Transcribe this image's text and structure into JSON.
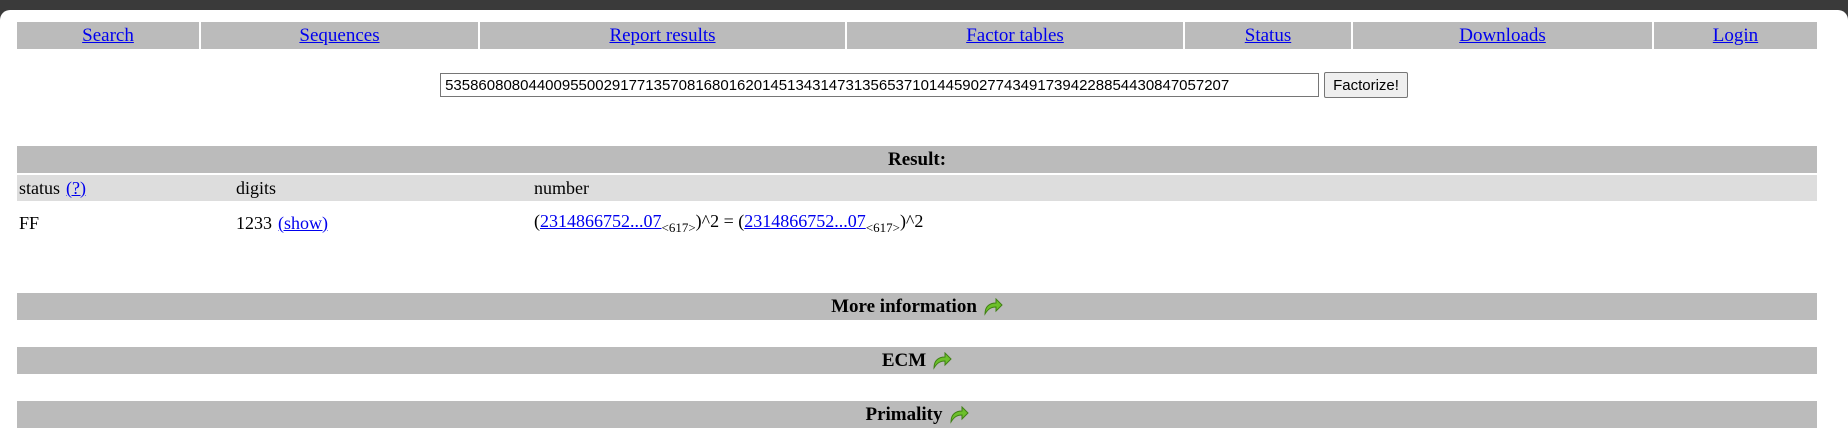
{
  "nav": [
    {
      "label": "Search",
      "name": "nav-search"
    },
    {
      "label": "Sequences",
      "name": "nav-sequences"
    },
    {
      "label": "Report results",
      "name": "nav-report-results"
    },
    {
      "label": "Factor tables",
      "name": "nav-factor-tables"
    },
    {
      "label": "Status",
      "name": "nav-status"
    },
    {
      "label": "Downloads",
      "name": "nav-downloads"
    },
    {
      "label": "Login",
      "name": "nav-login"
    }
  ],
  "search": {
    "value": "5358608080440095500291771357081680162014513431473135653710144590277434917394228854430847057207",
    "button_label": "Factorize!"
  },
  "result": {
    "header": "Result:",
    "columns": {
      "status": "status",
      "status_help": "(?)",
      "digits": "digits",
      "number": "number"
    },
    "row": {
      "status": "FF",
      "digits": "1233",
      "show": "(show)",
      "lhs_open": "(",
      "lhs_link": "2314866752...07",
      "lhs_sub": "<617>",
      "lhs_close": ")^2 = (",
      "rhs_link": "2314866752...07",
      "rhs_sub": "<617>",
      "rhs_close": ")^2"
    }
  },
  "sections": {
    "more_info": "More information",
    "ecm": "ECM",
    "primality": "Primality"
  },
  "colors": {
    "bar": "#bbbbbb",
    "subbar": "#dddddd",
    "link": "#0000ee",
    "arrow": "#6cc02a"
  },
  "icons": {
    "section_arrow": "green-curved-arrow-icon"
  }
}
